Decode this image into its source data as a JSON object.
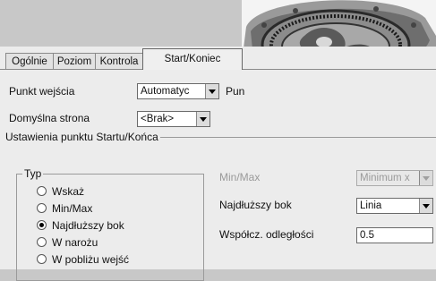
{
  "tabs": [
    {
      "label": "Ogólnie"
    },
    {
      "label": "Poziom"
    },
    {
      "label": "Kontrola"
    },
    {
      "label": "Start/Koniec"
    }
  ],
  "active_tab": "Start/Koniec",
  "entry": {
    "label": "Punkt wejścia",
    "value": "Automatyc",
    "side_label_cut": "Pun"
  },
  "default_side": {
    "label": "Domyślna strona",
    "value": "<Brak>"
  },
  "section": {
    "title": "Ustawienia punktu Startu/Końca"
  },
  "type_group": {
    "legend": "Typ",
    "options": [
      {
        "label": "Wskaż",
        "checked": false
      },
      {
        "label": "Min/Max",
        "checked": false
      },
      {
        "label": "Najdłuższy bok",
        "checked": true
      },
      {
        "label": "W narożu",
        "checked": false
      },
      {
        "label": "W pobliżu wejść",
        "checked": false
      }
    ]
  },
  "minmax": {
    "label": "Min/Max",
    "value": "Minimum x",
    "enabled": false
  },
  "longest_side": {
    "label": "Najdłuższy bok",
    "value": "Linia"
  },
  "distance_coeff": {
    "label": "Współcz. odległości",
    "value": "0.5"
  },
  "colors": {
    "dialog_bg": "#ececec",
    "render_bg": "#f4f4f4"
  }
}
